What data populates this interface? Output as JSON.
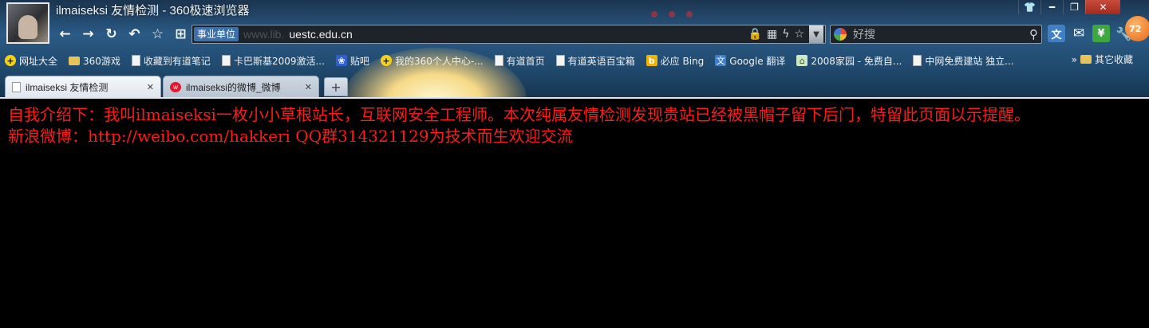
{
  "window": {
    "title": "ilmaiseksi 友情检测 - 360极速浏览器",
    "controls": [
      "shirt-icon",
      "minimize-icon",
      "restore-icon",
      "close-icon"
    ],
    "notification_count": "72"
  },
  "navigation": {
    "buttons": [
      "back-icon",
      "forward-icon",
      "refresh-icon",
      "undo-icon",
      "star-icon",
      "apps-icon"
    ]
  },
  "address_bar": {
    "zone_label": "事业单位",
    "url_ghost": "www.lib.",
    "url": "uestc.edu.cn"
  },
  "search": {
    "placeholder": "好搜"
  },
  "bookmarks": [
    {
      "label": "网址大全",
      "icon": "plus-icon"
    },
    {
      "label": "360游戏",
      "icon": "folder-icon"
    },
    {
      "label": "收藏到有道笔记",
      "icon": "page-icon"
    },
    {
      "label": "卡巴斯基2009激活...",
      "icon": "page-icon"
    },
    {
      "label": "贴吧",
      "icon": "paw-icon"
    },
    {
      "label": "我的360个人中心-...",
      "icon": "plus-icon"
    },
    {
      "label": "有道首页",
      "icon": "page-icon"
    },
    {
      "label": "有道英语百宝箱",
      "icon": "page-icon"
    },
    {
      "label": "必应 Bing",
      "icon": "bing-icon"
    },
    {
      "label": "Google 翻译",
      "icon": "translate-icon"
    },
    {
      "label": "2008家园 - 免费自...",
      "icon": "house-icon"
    },
    {
      "label": "中网免费建站 独立...",
      "icon": "page-icon"
    }
  ],
  "bookmarks_more": "»",
  "bookmarks_other": "其它收藏",
  "tabs": [
    {
      "label": "ilmaiseksi 友情检测",
      "active": true
    },
    {
      "label": "ilmaiseksi的微博_微博",
      "active": false
    }
  ],
  "new_tab_label": "+",
  "content": {
    "line1": "自我介绍下：我叫ilmaiseksi一枚小小草根站长，互联网安全工程师。本次纯属友情检测发现贵站已经被黑帽子留下后门，特留此页面以示提醒。",
    "line2": "新浪微博：http://weibo.com/hakkeri QQ群314321129为技术而生欢迎交流",
    "text_color": "#ff1a1a",
    "background": "#000000"
  }
}
